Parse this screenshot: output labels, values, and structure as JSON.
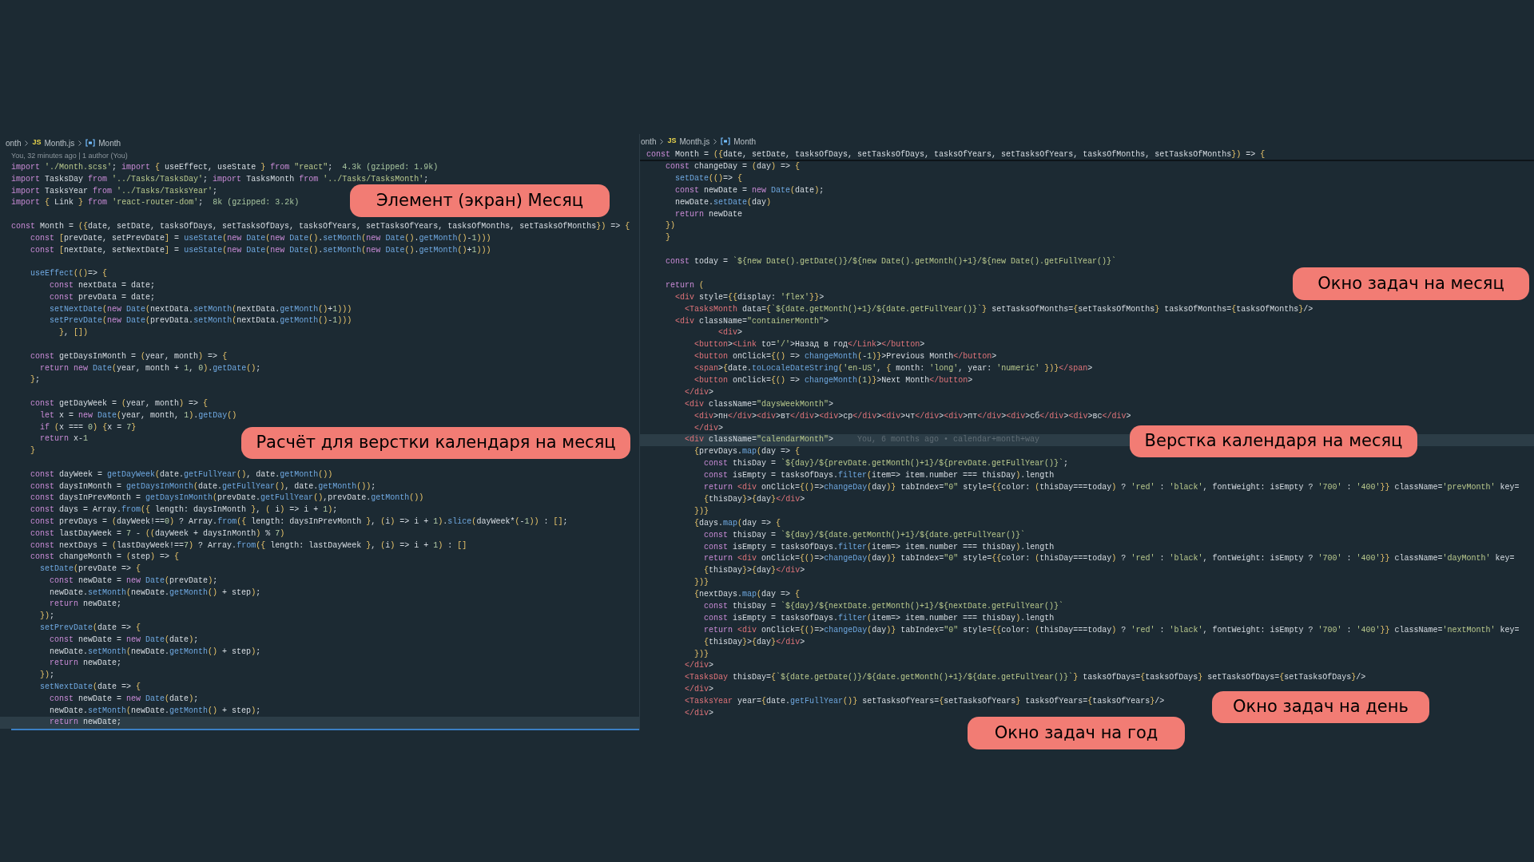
{
  "panels": [
    {
      "breadcrumb": {
        "path": "onth",
        "file_badge": "JS",
        "file": "Month.js",
        "symbol": "Month"
      },
      "codelens": "You, 32 minutes ago | 1 author (You)",
      "lines": [
        {
          "kind": "code",
          "text": "import './Month.scss'; import { useEffect, useState } from \"react\";",
          "hint": "4.3k (gzipped: 1.9k)",
          "current": false
        },
        {
          "kind": "code",
          "text": "import TasksDay from '../Tasks/TasksDay'; import TasksMonth from '../Tasks/TasksMonth';",
          "current": false
        },
        {
          "kind": "code",
          "text": "import TasksYear from '../Tasks/TasksYear';",
          "current": false
        },
        {
          "kind": "code",
          "text": "import { Link } from 'react-router-dom';",
          "hint": "8k (gzipped: 3.2k)",
          "current": false
        },
        {
          "kind": "blank"
        },
        {
          "kind": "code",
          "text": "const Month = ({date, setDate, tasksOfDays, setTasksOfDays, tasksOfYears, setTasksOfYears, tasksOfMonths, setTasksOfMonths}) => {",
          "current": false
        },
        {
          "kind": "code",
          "text": "    const [prevDate, setPrevDate] = useState(new Date(new Date().setMonth(new Date().getMonth()-1)))",
          "current": false
        },
        {
          "kind": "code",
          "text": "    const [nextDate, setNextDate] = useState(new Date(new Date().setMonth(new Date().getMonth()+1)))",
          "current": false
        },
        {
          "kind": "blank"
        },
        {
          "kind": "code",
          "text": "    useEffect(()=> {",
          "current": false
        },
        {
          "kind": "code",
          "text": "        const nextData = date;",
          "current": false
        },
        {
          "kind": "code",
          "text": "        const prevData = date;",
          "current": false
        },
        {
          "kind": "code",
          "text": "        setNextDate(new Date(nextData.setMonth(nextData.getMonth()+1)))",
          "current": false
        },
        {
          "kind": "code",
          "text": "        setPrevDate(new Date(prevData.setMonth(nextData.getMonth()-1)))",
          "current": false
        },
        {
          "kind": "code",
          "text": "          }, [])",
          "current": false
        },
        {
          "kind": "blank"
        },
        {
          "kind": "code",
          "text": "    const getDaysInMonth = (year, month) => {",
          "current": false
        },
        {
          "kind": "code",
          "text": "      return new Date(year, month + 1, 0).getDate();",
          "current": false
        },
        {
          "kind": "code",
          "text": "    };",
          "current": false
        },
        {
          "kind": "blank"
        },
        {
          "kind": "code",
          "text": "    const getDayWeek = (year, month) => {",
          "current": false
        },
        {
          "kind": "code",
          "text": "      let x = new Date(year, month, 1).getDay()",
          "current": false
        },
        {
          "kind": "code",
          "text": "      if (x === 0) {x = 7}",
          "current": false
        },
        {
          "kind": "code",
          "text": "      return x-1",
          "current": false
        },
        {
          "kind": "code",
          "text": "    }",
          "current": false
        },
        {
          "kind": "blank"
        },
        {
          "kind": "code",
          "text": "    const dayWeek = getDayWeek(date.getFullYear(), date.getMonth())",
          "current": false
        },
        {
          "kind": "code",
          "text": "    const daysInMonth = getDaysInMonth(date.getFullYear(), date.getMonth());",
          "current": false
        },
        {
          "kind": "code",
          "text": "    const daysInPrevMonth = getDaysInMonth(prevDate.getFullYear(),prevDate.getMonth())",
          "current": false
        },
        {
          "kind": "code",
          "text": "    const days = Array.from({ length: daysInMonth }, ( i) => i + 1);",
          "current": false
        },
        {
          "kind": "code",
          "text": "    const prevDays = (dayWeek!==0) ? Array.from({ length: daysInPrevMonth }, (i) => i + 1).slice(dayWeek*(-1)) : [];",
          "current": false
        },
        {
          "kind": "code",
          "text": "    const lastDayWeek = 7 - ((dayWeek + daysInMonth) % 7)",
          "current": false
        },
        {
          "kind": "code",
          "text": "    const nextDays = (lastDayWeek!==7) ? Array.from({ length: lastDayWeek }, (i) => i + 1) : []",
          "current": false
        },
        {
          "kind": "code",
          "text": "    const changeMonth = (step) => {",
          "current": false
        },
        {
          "kind": "code",
          "text": "      setDate(prevDate => {",
          "current": false
        },
        {
          "kind": "code",
          "text": "        const newDate = new Date(prevDate);",
          "current": false
        },
        {
          "kind": "code",
          "text": "        newDate.setMonth(newDate.getMonth() + step);",
          "current": false
        },
        {
          "kind": "code",
          "text": "        return newDate;",
          "current": false
        },
        {
          "kind": "code",
          "text": "      });",
          "current": false
        },
        {
          "kind": "code",
          "text": "      setPrevDate(date => {",
          "current": false
        },
        {
          "kind": "code",
          "text": "        const newDate = new Date(date);",
          "current": false
        },
        {
          "kind": "code",
          "text": "        newDate.setMonth(newDate.getMonth() + step);",
          "current": false
        },
        {
          "kind": "code",
          "text": "        return newDate;",
          "current": false
        },
        {
          "kind": "code",
          "text": "      });",
          "current": false
        },
        {
          "kind": "code",
          "text": "      setNextDate(date => {",
          "current": false
        },
        {
          "kind": "code",
          "text": "        const newDate = new Date(date);",
          "current": false
        },
        {
          "kind": "code",
          "text": "        newDate.setMonth(newDate.getMonth() + step);",
          "current": false
        },
        {
          "kind": "code",
          "text": "        return newDate;",
          "current": true
        }
      ]
    },
    {
      "breadcrumb": {
        "path": "onth",
        "file_badge": "JS",
        "file": "Month.js",
        "symbol": "Month"
      },
      "sticky_line": "const Month = ({date, setDate, tasksOfDays, setTasksOfDays, tasksOfYears, setTasksOfYears, tasksOfMonths, setTasksOfMonths}) => {",
      "lines": [
        {
          "kind": "code",
          "text": "    const changeDay = (day) => {",
          "current": false
        },
        {
          "kind": "code",
          "text": "      setDate(()=> {",
          "current": false
        },
        {
          "kind": "code",
          "text": "      const newDate = new Date(date);",
          "current": false
        },
        {
          "kind": "code",
          "text": "      newDate.setDate(day)",
          "current": false
        },
        {
          "kind": "code",
          "text": "      return newDate",
          "current": false
        },
        {
          "kind": "code",
          "text": "    })",
          "current": false
        },
        {
          "kind": "code",
          "text": "    }",
          "current": false
        },
        {
          "kind": "blank"
        },
        {
          "kind": "code",
          "text": "    const today = `${new Date().getDate()}/${new Date().getMonth()+1}/${new Date().getFullYear()}`",
          "current": false
        },
        {
          "kind": "blank"
        },
        {
          "kind": "code",
          "text": "    return (",
          "current": false
        },
        {
          "kind": "code",
          "text": "      <div style={{display: 'flex'}}>",
          "current": false
        },
        {
          "kind": "code",
          "text": "        <TasksMonth data={`${date.getMonth()+1}/${date.getFullYear()}`} setTasksOfMonths={setTasksOfMonths} tasksOfMonths={tasksOfMonths}/>",
          "current": false
        },
        {
          "kind": "code",
          "text": "      <div className=\"containerMonth\">",
          "current": false
        },
        {
          "kind": "code",
          "text": "               <div>",
          "current": false
        },
        {
          "kind": "code",
          "text": "          <button><Link to='/'>Назад в год</Link></button>",
          "current": false
        },
        {
          "kind": "code",
          "text": "          <button onClick={() => changeMonth(-1)}>Previous Month</button>",
          "current": false
        },
        {
          "kind": "code",
          "text": "          <span>{date.toLocaleDateString('en-US', { month: 'long', year: 'numeric' })}</span>",
          "current": false
        },
        {
          "kind": "code",
          "text": "          <button onClick={() => changeMonth(1)}>Next Month</button>",
          "current": false
        },
        {
          "kind": "code",
          "text": "        </div>",
          "current": false
        },
        {
          "kind": "code",
          "text": "        <div className=\"daysWeekMonth\">",
          "current": false
        },
        {
          "kind": "code",
          "text": "          <div>пн</div><div>вт</div><div>ср</div><div>чт</div><div>пт</div><div>сб</div><div>вс</div>",
          "current": false
        },
        {
          "kind": "code",
          "text": "          </div>",
          "current": false
        },
        {
          "kind": "code",
          "text": "        <div className=\"calendarMonth\">",
          "hint": "You, 6 months ago • calendar+month+way",
          "current": true
        },
        {
          "kind": "code",
          "text": "          {prevDays.map(day => {",
          "current": false
        },
        {
          "kind": "code",
          "text": "            const thisDay = `${day}/${prevDate.getMonth()+1}/${prevDate.getFullYear()}`;",
          "current": false
        },
        {
          "kind": "code",
          "text": "            const isEmpty = tasksOfDays.filter(item=> item.number === thisDay).length",
          "current": false
        },
        {
          "kind": "code",
          "text": "            return <div onClick={()=>changeDay(day)} tabIndex=\"0\" style={{color: (thisDay===today) ? 'red' : 'black', fontWeight: isEmpty ? '700' : '400'}} className='prevMonth' key=",
          "current": false
        },
        {
          "kind": "code",
          "text": "            {thisDay}>{day}</div>",
          "current": false
        },
        {
          "kind": "code",
          "text": "          })}",
          "current": false
        },
        {
          "kind": "code",
          "text": "          {days.map(day => {",
          "current": false
        },
        {
          "kind": "code",
          "text": "            const thisDay = `${day}/${date.getMonth()+1}/${date.getFullYear()}`",
          "current": false
        },
        {
          "kind": "code",
          "text": "            const isEmpty = tasksOfDays.filter(item=> item.number === thisDay).length",
          "current": false
        },
        {
          "kind": "code",
          "text": "            return <div onClick={()=>changeDay(day)} tabIndex=\"0\" style={{color: (thisDay===today) ? 'red' : 'black', fontWeight: isEmpty ? '700' : '400'}} className='dayMonth' key=",
          "current": false
        },
        {
          "kind": "code",
          "text": "            {thisDay}>{day}</div>",
          "current": false
        },
        {
          "kind": "code",
          "text": "          })}",
          "current": false
        },
        {
          "kind": "code",
          "text": "          {nextDays.map(day => {",
          "current": false
        },
        {
          "kind": "code",
          "text": "            const thisDay = `${day}/${nextDate.getMonth()+1}/${nextDate.getFullYear()}`",
          "current": false
        },
        {
          "kind": "code",
          "text": "            const isEmpty = tasksOfDays.filter(item=> item.number === thisDay).length",
          "current": false
        },
        {
          "kind": "code",
          "text": "            return <div onClick={()=>changeDay(day)} tabIndex=\"0\" style={{color: (thisDay===today) ? 'red' : 'black', fontWeight: isEmpty ? '700' : '400'}} className='nextMonth' key=",
          "current": false
        },
        {
          "kind": "code",
          "text": "            {thisDay}>{day}</div>",
          "current": false
        },
        {
          "kind": "code",
          "text": "          })}",
          "current": false
        },
        {
          "kind": "code",
          "text": "        </div>",
          "current": false
        },
        {
          "kind": "code",
          "text": "        <TasksDay thisDay={`${date.getDate()}/${date.getMonth()+1}/${date.getFullYear()}`} tasksOfDays={tasksOfDays} setTasksOfDays={setTasksOfDays}/>",
          "current": false
        },
        {
          "kind": "code",
          "text": "        </div>",
          "current": false
        },
        {
          "kind": "code",
          "text": "        <TasksYear year={date.getFullYear()} setTasksOfYears={setTasksOfYears} tasksOfYears={tasksOfYears}/>",
          "current": false
        },
        {
          "kind": "code",
          "text": "        </div>",
          "current": false
        }
      ]
    }
  ],
  "callouts": [
    {
      "text": "Элемент (экран) Месяц"
    },
    {
      "text": "Расчёт для верстки календаря на месяц"
    },
    {
      "text": "Окно задач на месяц"
    },
    {
      "text": "Верстка календаря на месяц"
    },
    {
      "text": "Окно задач на день"
    },
    {
      "text": "Окно задач на год"
    }
  ]
}
